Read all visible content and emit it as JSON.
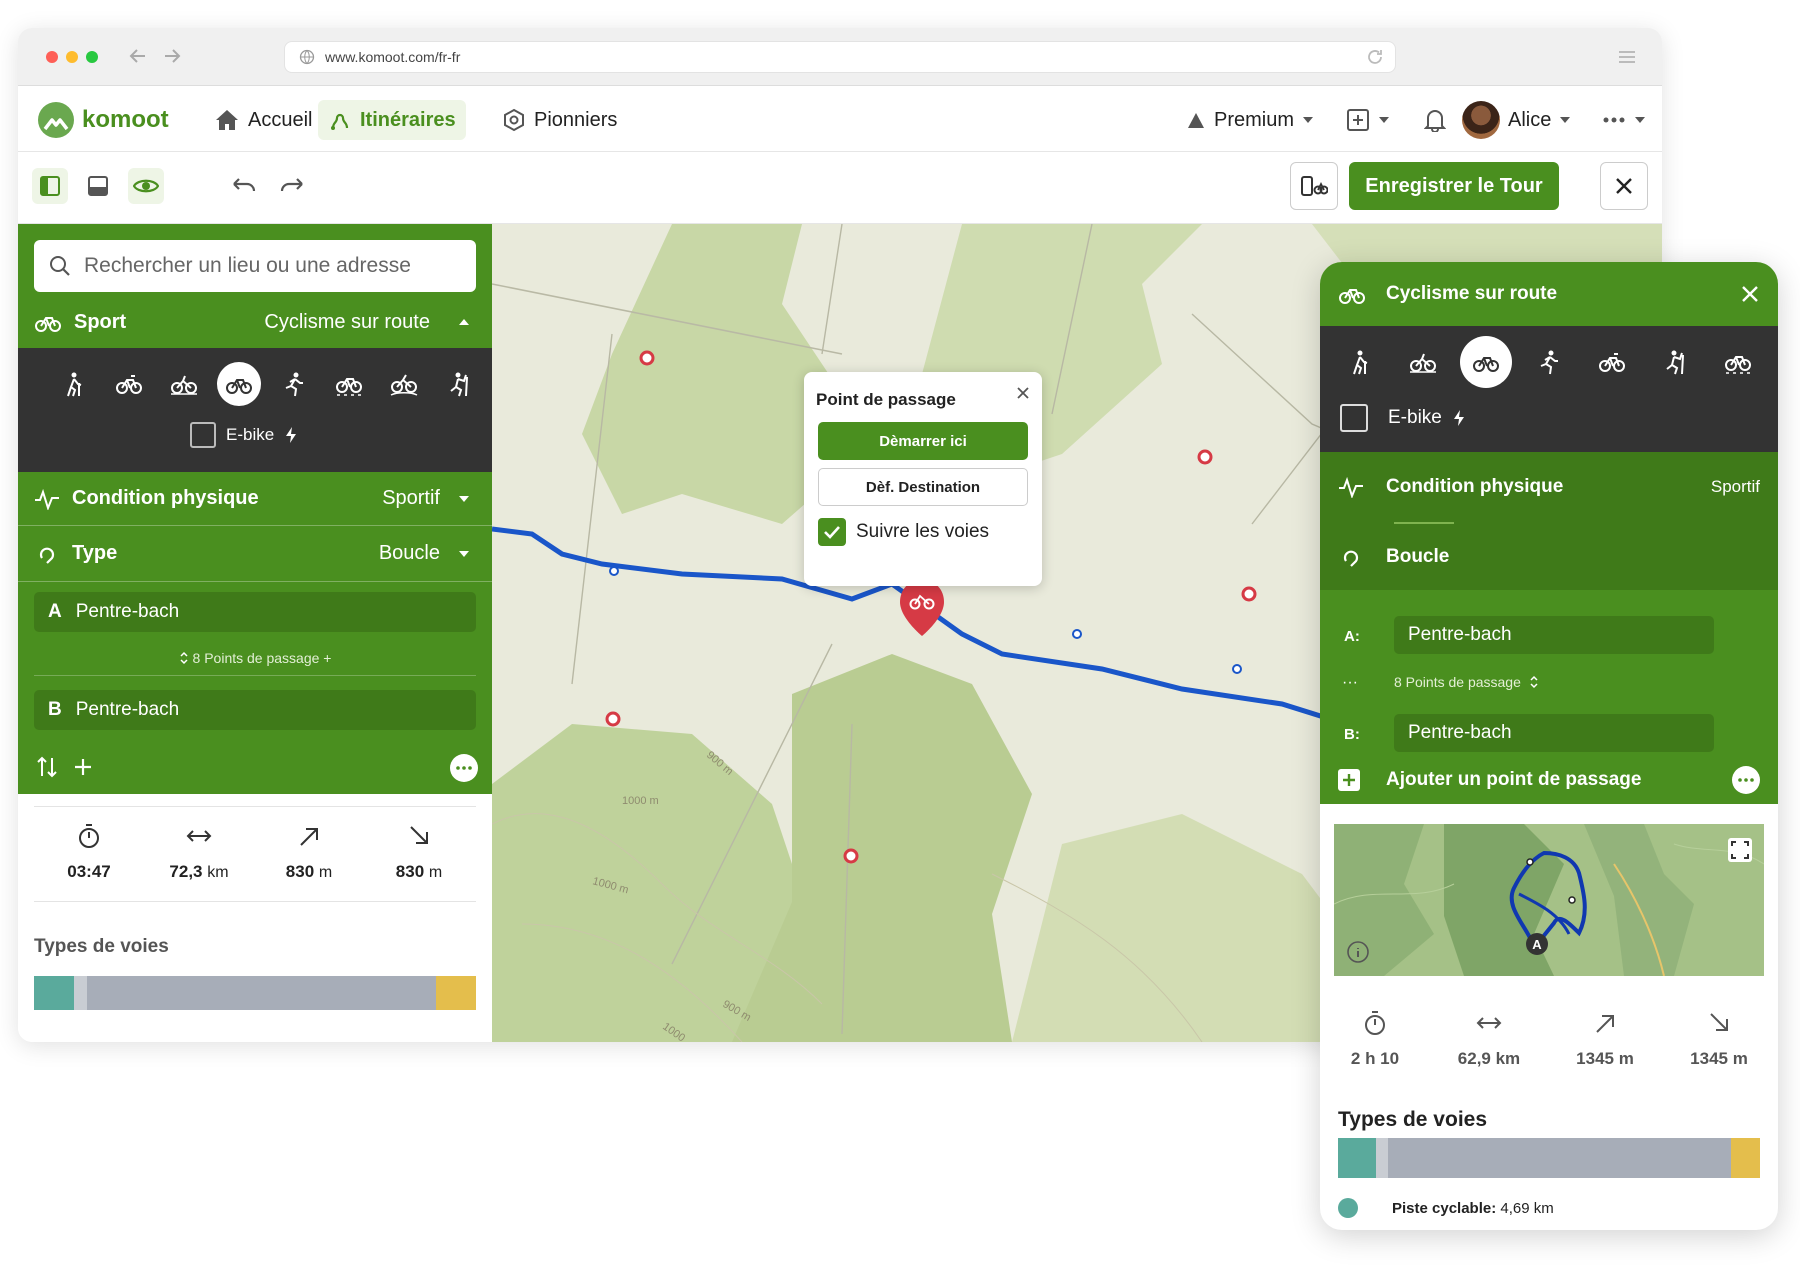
{
  "browser": {
    "url": "www.komoot.com/fr-fr"
  },
  "nav": {
    "brand": "komoot",
    "home": "Accueil",
    "routes": "Itinéraires",
    "pioneers": "Pionniers",
    "premium": "Premium",
    "user": "Alice"
  },
  "toolbar": {
    "save_label": "Enregistrer le Tour"
  },
  "sidebar": {
    "search_placeholder": "Rechercher un lieu ou une adresse",
    "sport_label": "Sport",
    "sport_value": "Cyclisme sur route",
    "ebike": "E-bike",
    "fitness_label": "Condition physique",
    "fitness_value": "Sportif",
    "type_label": "Type",
    "type_value": "Boucle",
    "point_a_letter": "A",
    "point_a": "Pentre-bach",
    "waypoints": "8 Points de passage +",
    "point_b_letter": "B",
    "point_b": "Pentre-bach",
    "stats": {
      "time": "03:47",
      "distance": "72,3",
      "distance_unit": "km",
      "up": "830",
      "up_unit": "m",
      "down": "830",
      "down_unit": "m"
    },
    "surfaces_title": "Types de voies",
    "surfaces_fill": [
      0.09,
      0.03,
      0.79,
      0.09
    ]
  },
  "popup": {
    "title": "Point de passage",
    "start": "Dèmarrer ici",
    "destination": "Dèf. Destination",
    "follow": "Suivre les voies"
  },
  "map_labels": {
    "c1": "900 m",
    "c2": "1000 m",
    "c3": "1000 m",
    "c4": "900 m",
    "c5": "1000"
  },
  "panel": {
    "sport": "Cyclisme sur route",
    "ebike": "E-bike",
    "fitness_label": "Condition physique",
    "fitness_value": "Sportif",
    "type_value": "Boucle",
    "a_label": "A:",
    "a_value": "Pentre-bach",
    "waypoints": "8 Points de passage",
    "b_label": "B:",
    "b_value": "Pentre-bach",
    "add_waypoint": "Ajouter un point de passage",
    "preview_marker": "A",
    "stats": {
      "time": "2 h 10",
      "distance": "62,9 km",
      "up": "1345 m",
      "down": "1345 m"
    },
    "surfaces_title": "Types de voies",
    "surfaces_fill": [
      0.09,
      0.03,
      0.82,
      0.07
    ],
    "legend_label": "Piste cyclable:",
    "legend_value": "4,69 km"
  },
  "colors": {
    "green": "#4a8f1f",
    "dark": "#333333",
    "route": "#1a56c9",
    "teal": "#5aaa9c",
    "gray": "#a7adb8",
    "yellow": "#e4be4c"
  }
}
